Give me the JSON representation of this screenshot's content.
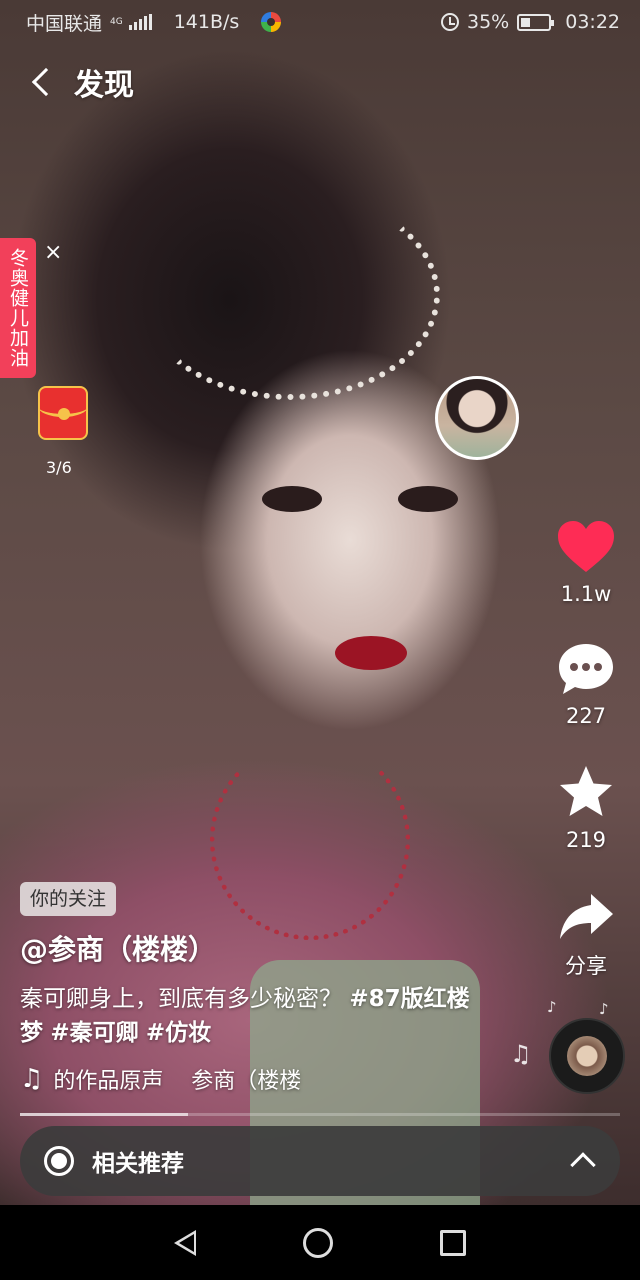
{
  "status_bar": {
    "carrier": "中国联通",
    "network_type": "4G",
    "speed": "141B/s",
    "battery": "35%",
    "battery_level": 0.35,
    "time": "03:22"
  },
  "header": {
    "back_icon": "chevron-left-icon",
    "title": "发现"
  },
  "promo": {
    "banner_text": "冬奥健儿加油",
    "close_label": "×",
    "envelope_progress": "3/6"
  },
  "actions": {
    "like_count": "1.1w",
    "comment_count": "227",
    "favorite_count": "219",
    "share_label": "分享",
    "like_color": "#fe2c55"
  },
  "post": {
    "follow_badge": "你的关注",
    "author": "@参商（楼楼）",
    "caption_text": "秦可卿身上，到底有多少秘密？",
    "hashtags": [
      "#87版红楼梦",
      "#秦可卿",
      "#仿妆"
    ],
    "music": "的作品原声    参商（楼楼",
    "progress": 0.28
  },
  "related": {
    "label": "相关推荐"
  },
  "system_nav": {
    "back_icon": "triangle-back-icon",
    "home_icon": "circle-home-icon",
    "recent_icon": "square-recent-icon"
  }
}
